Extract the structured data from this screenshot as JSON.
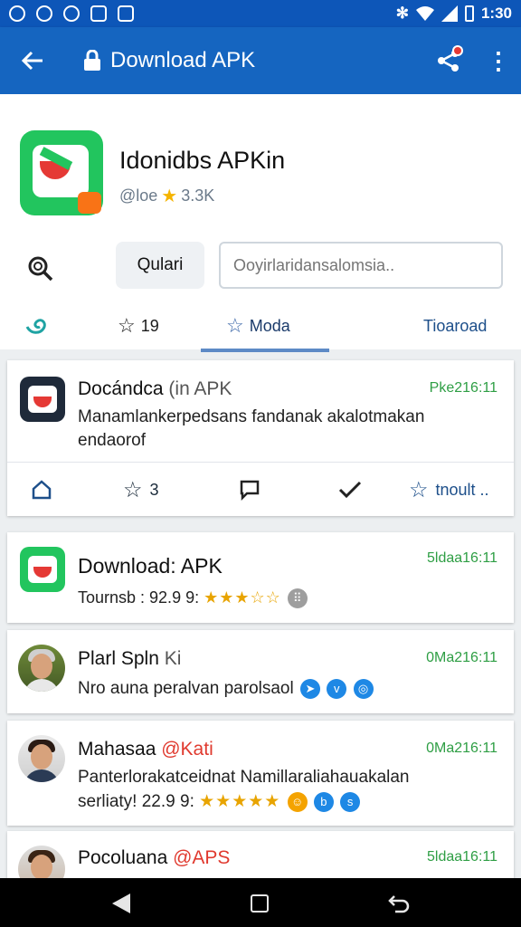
{
  "status_bar": {
    "time": "1:30"
  },
  "app_bar": {
    "title": "Download APK"
  },
  "header": {
    "app_name": "Idonidbs APKin",
    "rating_prefix": "@loe",
    "rating_count": "3.3K",
    "quick_button": "Qulari",
    "search_placeholder": "Ooyirlaridansalomsia.."
  },
  "tabs": [
    {
      "label": "",
      "icon": "swirl-icon"
    },
    {
      "label": "19",
      "icon": "star-outline-icon"
    },
    {
      "label": "Moda",
      "icon": "star-outline-icon",
      "active": true
    },
    {
      "label": "Tioaroad"
    }
  ],
  "cards": [
    {
      "title": "Docándca",
      "title_suffix": "(in APK",
      "time": "Pke216:11",
      "line1": "Manamlankerpedsans fandanak akalotmakan",
      "line2": "endaorof",
      "actions": {
        "like_count": "3",
        "more_label": "tnoult .."
      }
    },
    {
      "title": "Download: APK",
      "time": "5ldaa16:11",
      "stats_prefix": "Tournsb : 92.9 9:",
      "stars": "★★★☆☆",
      "avatar_icon": "gray-circle-icon"
    },
    {
      "title": "Plarl Spln",
      "handle": "Ki",
      "time": "0Ma216:11",
      "line1": "Nro auna peralvan parolsaol"
    },
    {
      "title": "Mahasaa",
      "handle": "@Kati",
      "time": "0Ma216:11",
      "line1": "Panterlorakatceidnat Namillaraliahauakalan",
      "line2_prefix": "serliaty! 22.9 9:",
      "stars": "★★★★★"
    },
    {
      "title": "Pocoluana",
      "handle": "@APS",
      "time": "5ldaa16:11"
    }
  ]
}
